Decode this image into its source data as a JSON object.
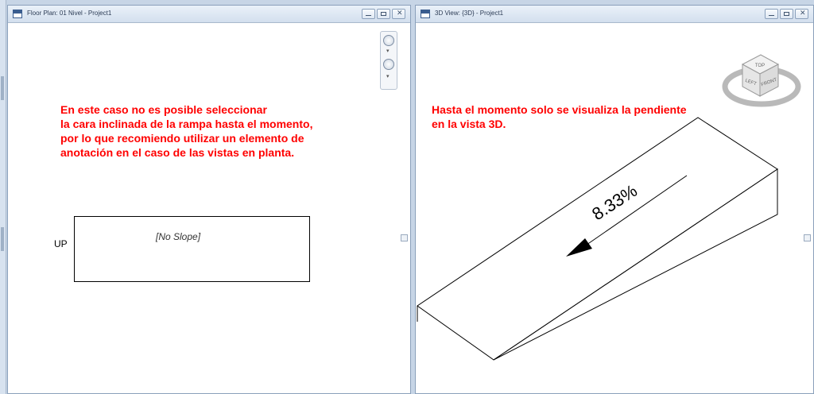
{
  "left_window": {
    "title": "Floor Plan: 01 Nivel - Project1",
    "note_lines": [
      "En este caso no es posible seleccionar",
      "la cara inclinada de la rampa hasta el momento,",
      "por lo que recomiendo utilizar un elemento de",
      "anotación en el caso de las vistas en planta."
    ],
    "ramp_label": "[No Slope]",
    "up_label": "UP"
  },
  "right_window": {
    "title": "3D View: {3D} - Project1",
    "note_lines": [
      "Hasta el momento solo se visualiza la pendiente",
      "en la vista 3D."
    ],
    "slope_label": "8.33%",
    "viewcube": {
      "top": "TOP",
      "left": "LEFT",
      "front": "FRONT"
    }
  },
  "colors": {
    "annotation": "#ff0000",
    "titlebar": "#dbe6f3",
    "frame": "#8aa0bb"
  },
  "icons": [
    "app-icon",
    "minimize-icon",
    "restore-icon",
    "close-icon",
    "steering-wheel-icon",
    "zoom-icon",
    "viewcube-icon",
    "slope-arrow-icon"
  ]
}
